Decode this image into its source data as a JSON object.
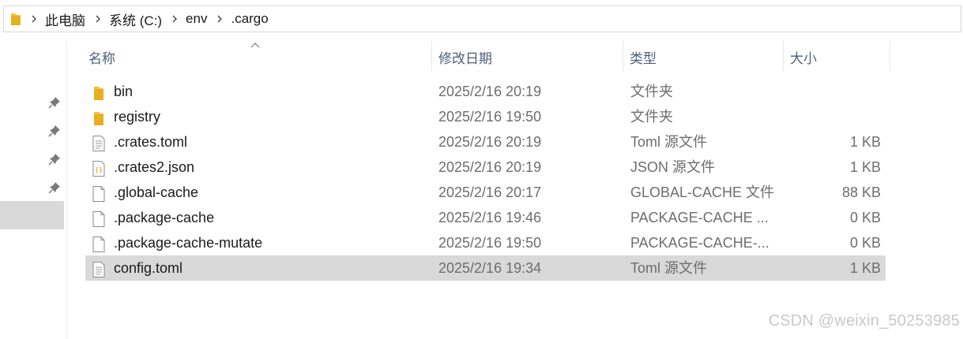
{
  "breadcrumb": [
    "此电脑",
    "系统 (C:)",
    "env",
    ".cargo"
  ],
  "columns": {
    "name": "名称",
    "date": "修改日期",
    "type": "类型",
    "size": "大小"
  },
  "files": [
    {
      "name": "bin",
      "date": "2025/2/16 20:19",
      "type": "文件夹",
      "size": "",
      "icon": "folder-icon"
    },
    {
      "name": "registry",
      "date": "2025/2/16 19:50",
      "type": "文件夹",
      "size": "",
      "icon": "folder-icon"
    },
    {
      "name": ".crates.toml",
      "date": "2025/2/16 20:19",
      "type": "Toml 源文件",
      "size": "1 KB",
      "icon": "text-file-icon"
    },
    {
      "name": ".crates2.json",
      "date": "2025/2/16 20:19",
      "type": "JSON 源文件",
      "size": "1 KB",
      "icon": "json-file-icon"
    },
    {
      "name": ".global-cache",
      "date": "2025/2/16 20:17",
      "type": "GLOBAL-CACHE 文件",
      "size": "88 KB",
      "icon": "blank-file-icon"
    },
    {
      "name": ".package-cache",
      "date": "2025/2/16 19:46",
      "type": "PACKAGE-CACHE ...",
      "size": "0 KB",
      "icon": "blank-file-icon"
    },
    {
      "name": ".package-cache-mutate",
      "date": "2025/2/16 19:50",
      "type": "PACKAGE-CACHE-...",
      "size": "0 KB",
      "icon": "blank-file-icon"
    },
    {
      "name": "config.toml",
      "date": "2025/2/16 19:34",
      "type": "Toml 源文件",
      "size": "1 KB",
      "icon": "text-file-icon",
      "selected": true
    }
  ],
  "watermark": "CSDN @weixin_50253985",
  "colors": {
    "selected_row": "#d9d9d9",
    "folder": "#f5c13d",
    "header_text": "#4c607a"
  }
}
